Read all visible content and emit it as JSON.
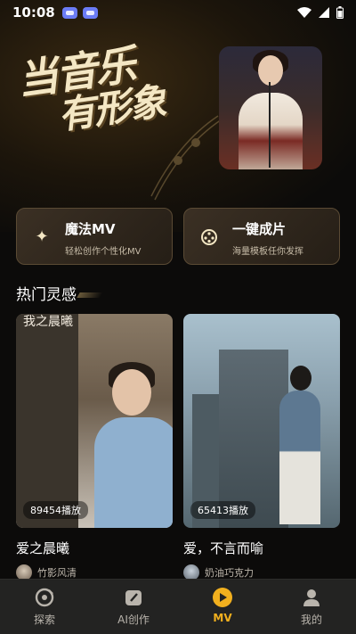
{
  "status_bar": {
    "time": "10:08"
  },
  "banner": {
    "headline_line1": "当音乐",
    "headline_line2": "有形象"
  },
  "quick_actions": [
    {
      "title": "魔法MV",
      "subtitle": "轻松创作个性化MV",
      "icon": "sparkle-icon"
    },
    {
      "title": "一键成片",
      "subtitle": "海量模板任你发挥",
      "icon": "film-reel-icon"
    }
  ],
  "section": {
    "title": "热门灵感"
  },
  "feed": [
    {
      "plays": "89454播放",
      "title": "爱之晨曦",
      "author": "竹影风清",
      "thumb_text": "我之晨曦"
    },
    {
      "plays": "65413播放",
      "title": "爱，不言而喻",
      "author": "奶油巧克力"
    }
  ],
  "tabbar": {
    "items": [
      {
        "label": "探索",
        "icon": "explore-icon",
        "active": false
      },
      {
        "label": "AI创作",
        "icon": "ai-create-icon",
        "active": false
      },
      {
        "label": "MV",
        "icon": "play-icon",
        "active": true
      },
      {
        "label": "我的",
        "icon": "profile-icon",
        "active": false
      }
    ]
  },
  "colors": {
    "accent": "#f2b01e",
    "background": "#0c0b0a",
    "card": "#2e251b"
  }
}
